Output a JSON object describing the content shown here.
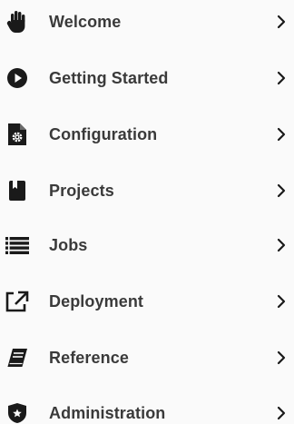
{
  "menu": {
    "items": [
      {
        "label": "Welcome",
        "icon": "hand-stop-icon"
      },
      {
        "label": "Getting Started",
        "icon": "play-circle-icon"
      },
      {
        "label": "Configuration",
        "icon": "file-gear-icon"
      },
      {
        "label": "Projects",
        "icon": "book-icon"
      },
      {
        "label": "Jobs",
        "icon": "list-icon"
      },
      {
        "label": "Deployment",
        "icon": "external-link-icon"
      },
      {
        "label": "Reference",
        "icon": "book-open-icon"
      },
      {
        "label": "Administration",
        "icon": "shield-star-icon"
      }
    ]
  },
  "colors": {
    "icon": "#1a1a1a",
    "text": "#3a3a3a",
    "background": "#fafafa"
  }
}
